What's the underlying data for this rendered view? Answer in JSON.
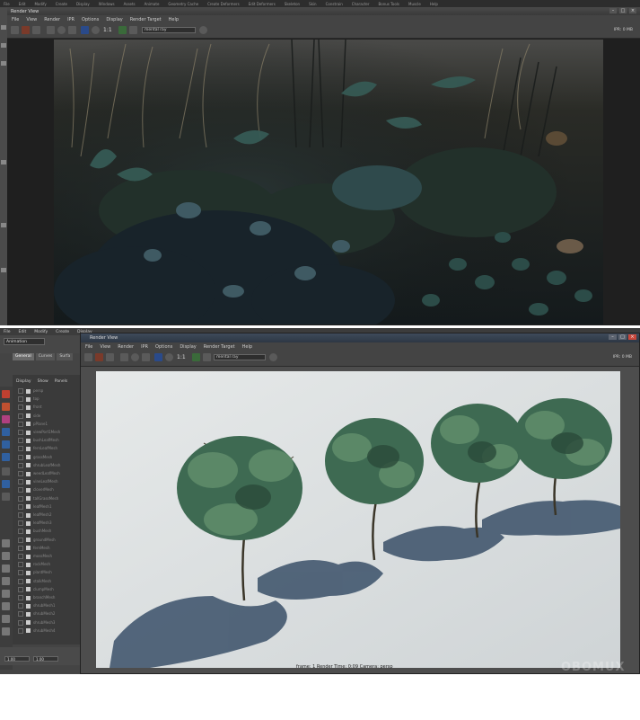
{
  "top": {
    "maya_menu": [
      "File",
      "Edit",
      "Modify",
      "Create",
      "Display",
      "Windows",
      "Assets",
      "Animate",
      "Geometry Cache",
      "Create Deformers",
      "Edit Deformers",
      "Skeleton",
      "Skin",
      "Constrain",
      "Character",
      "Bonus Tools",
      "Muscle",
      "Help"
    ],
    "window_title": "Render View",
    "menu": [
      "File",
      "View",
      "Render",
      "IPR",
      "Options",
      "Display",
      "Render Target",
      "Help"
    ],
    "ratio": "1:1",
    "renderer": "mental ray",
    "ipr_status": "IPR: 0 MB"
  },
  "bottom": {
    "maya_menu": [
      "File",
      "Edit",
      "Modify",
      "Create",
      "Display"
    ],
    "mode": "Animation",
    "shelf_tabs": [
      "General",
      "Curves",
      "Surfa"
    ],
    "outliner_menu": [
      "Display",
      "Show",
      "Panels"
    ],
    "outliner_items": [
      "persp",
      "top",
      "front",
      "side",
      "pPlane1",
      "viewPort1Mesh",
      "bushLeafMesh",
      "fernLeafMesh",
      "grassMesh",
      "shrubLeafMesh",
      "weedLeafMesh",
      "vineLeafMesh",
      "cloverMesh",
      "tallGrassMesh",
      "leafMesh1",
      "leafMesh2",
      "leafMesh3",
      "bushMesh",
      "groundMesh",
      "fernMesh",
      "mossMesh",
      "rockMesh",
      "plantMesh",
      "stalkMesh",
      "clumpMesh",
      "branchMesh",
      "shrubMesh1",
      "shrubMesh2",
      "shrubMesh3",
      "shrubMesh4"
    ],
    "render_window_title": "Render View",
    "menu": [
      "File",
      "View",
      "Render",
      "IPR",
      "Options",
      "Display",
      "Render Target",
      "Help"
    ],
    "ratio": "1:1",
    "renderer": "mental ray",
    "ipr_status": "IPR: 0 MB",
    "time_start": "1.00",
    "time_end": "1.00",
    "status_line": "frame: 1     Render Time: 0:09     Camera: persp",
    "watermark": "OBOMUX"
  }
}
